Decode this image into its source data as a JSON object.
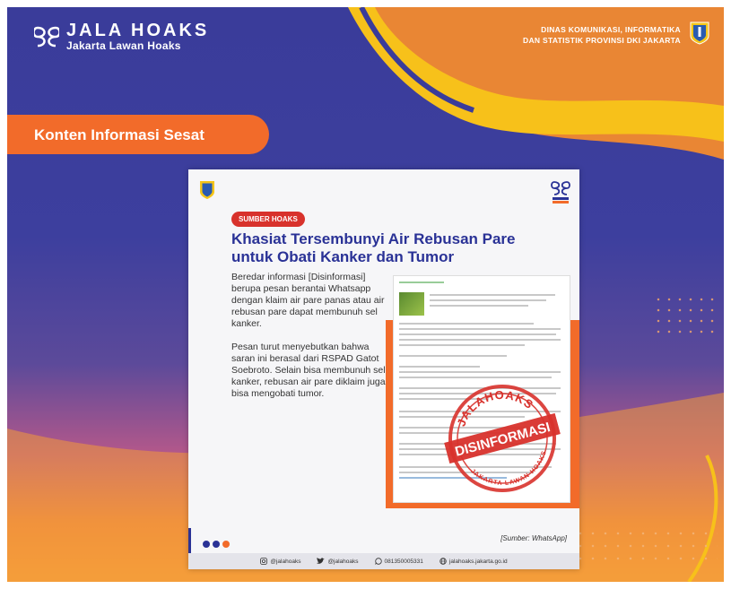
{
  "brand": {
    "title": "JALA HOAKS",
    "subtitle": "Jakarta Lawan Hoaks",
    "agency_line1": "DINAS KOMUNIKASI, INFORMATIKA",
    "agency_line2": "DAN STATISTIK PROVINSI DKI JAKARTA"
  },
  "banner": {
    "label": "Konten Informasi Sesat"
  },
  "card": {
    "badge": "SUMBER HOAKS",
    "title_line1": "Khasiat Tersembunyi Air Rebusan Pare",
    "title_line2": "untuk Obati Kanker dan Tumor",
    "paragraph1": "Beredar informasi [Disinformasi] berupa pesan berantai Whatsapp dengan klaim air pare panas atau air rebusan pare dapat membunuh sel kanker.",
    "paragraph2": "Pesan turut menyebutkan bahwa saran ini berasal dari RSPAD Gatot Soebroto. Selain bisa membunuh sel kanker, rebusan air pare diklaim juga bisa mengobati tumor.",
    "stamp_top": "JALAHOAKS",
    "stamp_main": "DISINFORMASI",
    "stamp_bottom": "JAKARTA LAWAN HOAKS",
    "source": "[Sumber: WhatsApp]"
  },
  "footer": {
    "instagram": "@jalahoaks",
    "twitter": "@jalahoaks",
    "whatsapp": "081350005331",
    "website": "jalahoaks.jakarta.go.id"
  },
  "colors": {
    "navy": "#2a3296",
    "orange": "#f26b2a",
    "red": "#d8322c",
    "gold": "#f5c518"
  }
}
